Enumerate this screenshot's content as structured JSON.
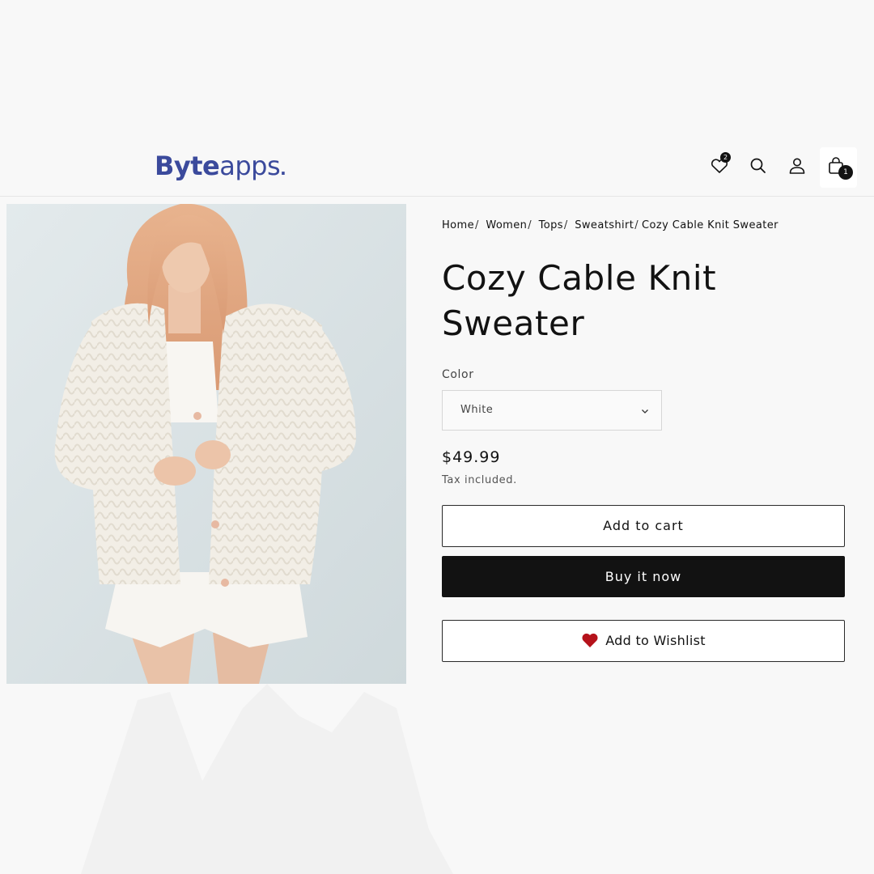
{
  "brand": {
    "logo_bold": "Byte",
    "logo_light": "apps",
    "logo_dot": ".",
    "color": "#3b4a9c"
  },
  "header": {
    "icons": [
      {
        "name": "wishlist-heart-icon",
        "badge": "2"
      },
      {
        "name": "search-icon"
      },
      {
        "name": "account-icon"
      },
      {
        "name": "cart-bag-icon",
        "badge": "1"
      }
    ]
  },
  "breadcrumb": {
    "items": [
      "Home",
      "Women",
      "Tops",
      "Sweatshirt"
    ],
    "separator": "/",
    "current": "Cozy Cable Knit Sweater"
  },
  "product": {
    "title": "Cozy Cable Knit Sweater",
    "color_label": "Color",
    "color_selected": "White",
    "price": "$49.99",
    "tax_note": "Tax included."
  },
  "actions": {
    "add_to_cart": "Add to cart",
    "buy_now": "Buy it now",
    "add_to_wishlist": "Add to Wishlist"
  },
  "colors": {
    "primary_button_bg": "#121212",
    "wishlist_heart": "#b5121b",
    "page_bg": "#f8f8f8"
  }
}
